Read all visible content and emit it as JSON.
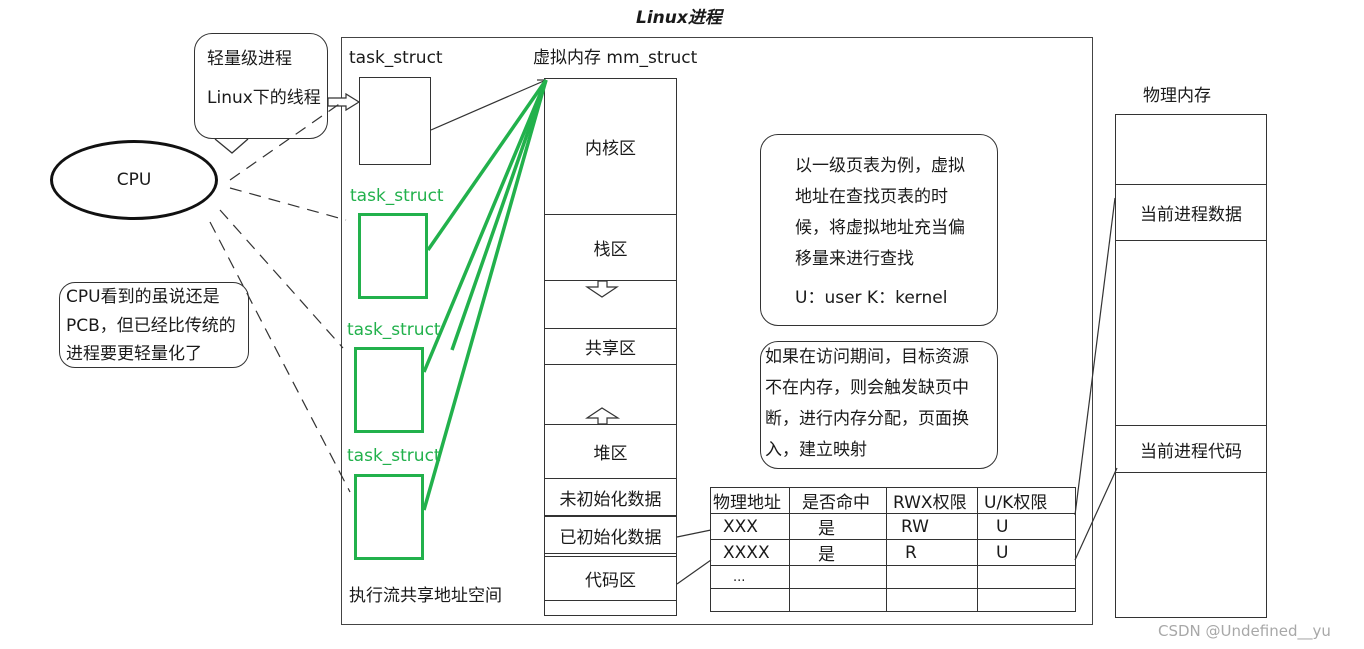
{
  "title": "Linux进程",
  "cpu": {
    "label": "CPU"
  },
  "callouts": {
    "lightweight": [
      "轻量级进程",
      "Linux下的线程"
    ],
    "cpu_note": [
      "CPU看到的虽说还是",
      "PCB，但已经比传统的",
      "进程要更轻量化了"
    ]
  },
  "process_frame": {
    "task_structs": [
      "task_struct",
      "task_struct",
      "task_struct",
      "task_struct"
    ],
    "shared_address_label": "执行流共享地址空间"
  },
  "virtual_memory": {
    "title": "虚拟内存 mm_struct",
    "segments": [
      "内核区",
      "栈区",
      "共享区",
      "堆区",
      "未初始化数据",
      "已初始化数据",
      "代码区"
    ]
  },
  "page_table_note": [
    "以一级页表为例，虚拟",
    "地址在查找页表的时",
    "候，将虚拟地址充当偏",
    "移量来进行查找",
    "U：user  K：kernel"
  ],
  "page_fault_note": [
    "如果在访问期间，目标资源",
    "不在内存，则会触发缺页中",
    "断，进行内存分配，页面换",
    "入，建立映射"
  ],
  "page_table": {
    "headers": [
      "物理地址",
      "是否命中",
      "RWX权限",
      "U/K权限"
    ],
    "rows": [
      [
        "XXX",
        "是",
        "RW",
        "U"
      ],
      [
        "XXXX",
        "是",
        "R",
        "U"
      ],
      [
        "...",
        "",
        "",
        ""
      ],
      [
        "",
        "",
        "",
        ""
      ]
    ]
  },
  "physical_memory": {
    "title": "物理内存",
    "segments": [
      "",
      "当前进程数据",
      "",
      "当前进程代码",
      ""
    ]
  },
  "watermark": "CSDN @Undefined__yu",
  "colors": {
    "thread_green": "#22b14c",
    "stroke": "#333333"
  }
}
